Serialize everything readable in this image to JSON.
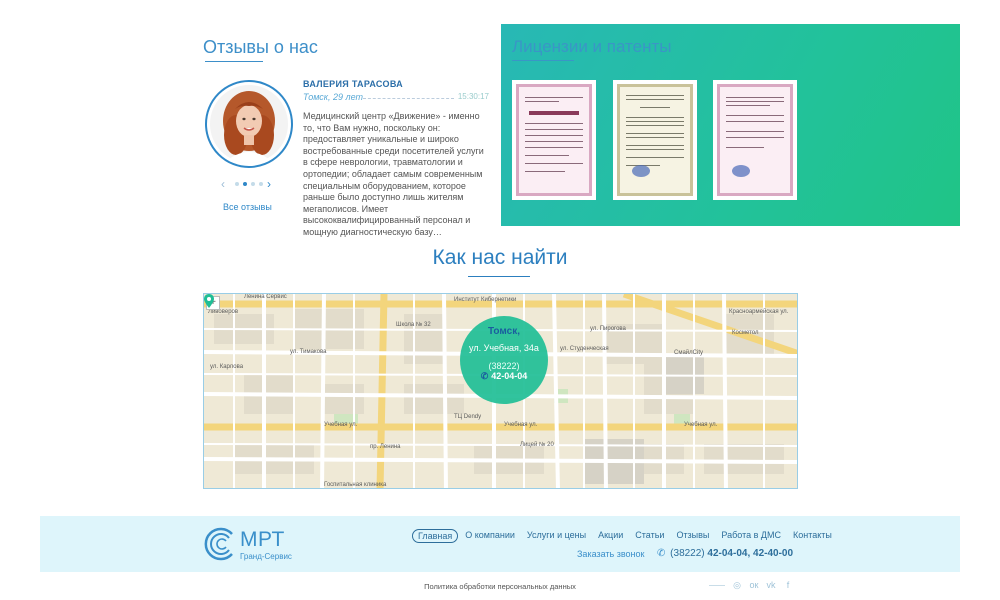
{
  "reviews": {
    "title": "Отзывы о нас",
    "name": "ВАЛЕРИЯ ТАРАСОВА",
    "city_age": "Томск, 29 лет",
    "time": "15:30:17",
    "text": "Медицинский центр «Движение» - именно то, что Вам нужно, поскольку он: предоставляет уникальные и широко востребованные среди посетителей услуги в сфере неврологии, травматологии и ортопедии; обладает самым современным специальным оборудованием, которое раньше было доступно лишь жителям мегаполисов. Имеет высококвалифицированный персонал и мощную диагностическую базу…",
    "all_link": "Все отзывы",
    "prev_icon": "chevron-left-icon",
    "next_icon": "chevron-right-icon"
  },
  "licenses": {
    "title": "Лицензии и патенты",
    "items": [
      "license-1",
      "license-2",
      "license-3"
    ]
  },
  "find": {
    "title": "Как нас найти"
  },
  "map": {
    "zoom_label": "+",
    "city": "Томск,",
    "street": "ул. Учебная, 34а",
    "code": "(38222)",
    "phone": "42-04-04",
    "labels": {
      "l1": "Ленина Сервис",
      "l2": "Ливоверов",
      "l3": "Институт Кибернетики",
      "l4": "Школа № 32",
      "l5": "ул. Тимакова",
      "l6": "ул. Пирогова",
      "l7": "Красноармейская ул.",
      "l8": "СмайлCity",
      "l9": "Учебная ул.",
      "l10": "пр. Ленина",
      "l11": "Учебная ул.",
      "l12": "Лицей № 20",
      "l13": "Учебная ул.",
      "l14": "Госпитальная клиника",
      "l15": "ул. Карлова",
      "l16": "ТЦ Dendy",
      "l17": "Косметол",
      "l18": "ул. Студенческая"
    }
  },
  "footer": {
    "logo_main": "МРТ",
    "logo_sub": "Гранд-Сервис",
    "nav": [
      "Главная",
      "О компании",
      "Услуги и цены",
      "Акции",
      "Статьи",
      "Отзывы",
      "Работа в ДМС",
      "Контакты"
    ],
    "callback": "Заказать звонок",
    "phone_prefix": "(38222)",
    "phones": "42-04-04, 42-40-00",
    "policy": "Политика обработки персональных данных",
    "social_icons": [
      "instagram-icon",
      "odnoklassniki-icon",
      "vk-icon",
      "facebook-icon"
    ],
    "social_glyphs": [
      "◎",
      "ок",
      "vk",
      "f"
    ]
  },
  "colors": {
    "accent": "#2f88c8",
    "licenses_bg": "#22c29a",
    "footer_bg": "#def5fb",
    "bubble": "#20be96"
  }
}
